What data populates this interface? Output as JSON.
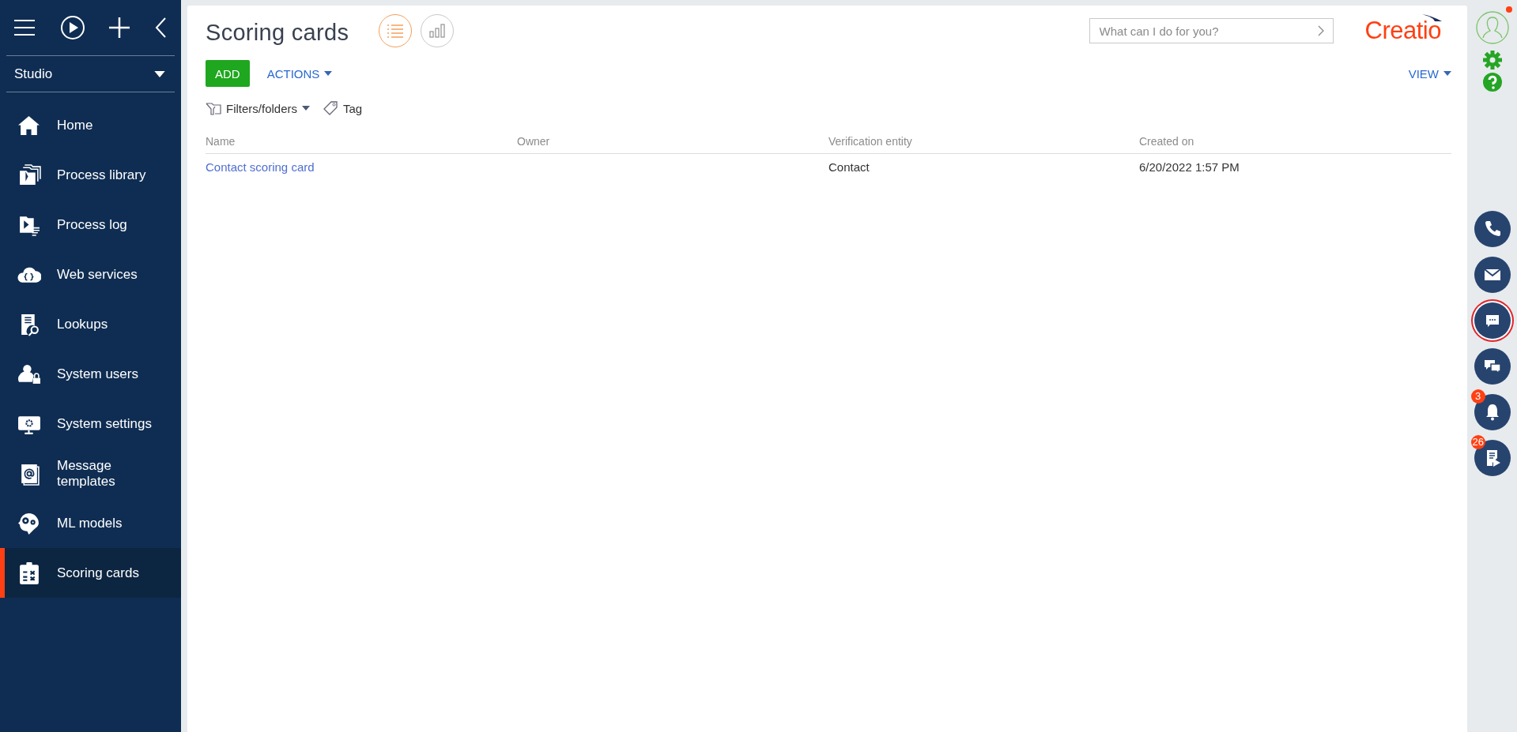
{
  "sidebar": {
    "workplace": "Studio",
    "items": [
      {
        "label": "Home",
        "selected": false
      },
      {
        "label": "Process library",
        "selected": false
      },
      {
        "label": "Process log",
        "selected": false
      },
      {
        "label": "Web services",
        "selected": false
      },
      {
        "label": "Lookups",
        "selected": false
      },
      {
        "label": "System users",
        "selected": false
      },
      {
        "label": "System settings",
        "selected": false
      },
      {
        "label": "Message templates",
        "selected": false
      },
      {
        "label": "ML models",
        "selected": false
      },
      {
        "label": "Scoring cards",
        "selected": true
      }
    ]
  },
  "header": {
    "title": "Scoring cards",
    "view_modes": [
      {
        "selected": true
      },
      {
        "selected": false
      }
    ],
    "search": {
      "placeholder": "What can I do for you?"
    },
    "logo": "Creatio"
  },
  "toolbar": {
    "add": "ADD",
    "actions": "ACTIONS",
    "view": "VIEW",
    "filters": "Filters/folders",
    "tag": "Tag"
  },
  "table": {
    "columns": [
      "Name",
      "Owner",
      "Verification entity",
      "Created on"
    ],
    "rows": [
      [
        "Contact scoring card",
        "",
        "Contact",
        "6/20/2022 1:57 PM"
      ]
    ]
  },
  "right_panel": {
    "profile": {
      "notification": true
    },
    "buttons": [
      {
        "ringed": false
      },
      {
        "ringed": false
      },
      {
        "ringed": true
      },
      {
        "ringed": false
      },
      {
        "ringed": false,
        "badge": "3"
      },
      {
        "ringed": false,
        "badge": "26"
      }
    ]
  }
}
